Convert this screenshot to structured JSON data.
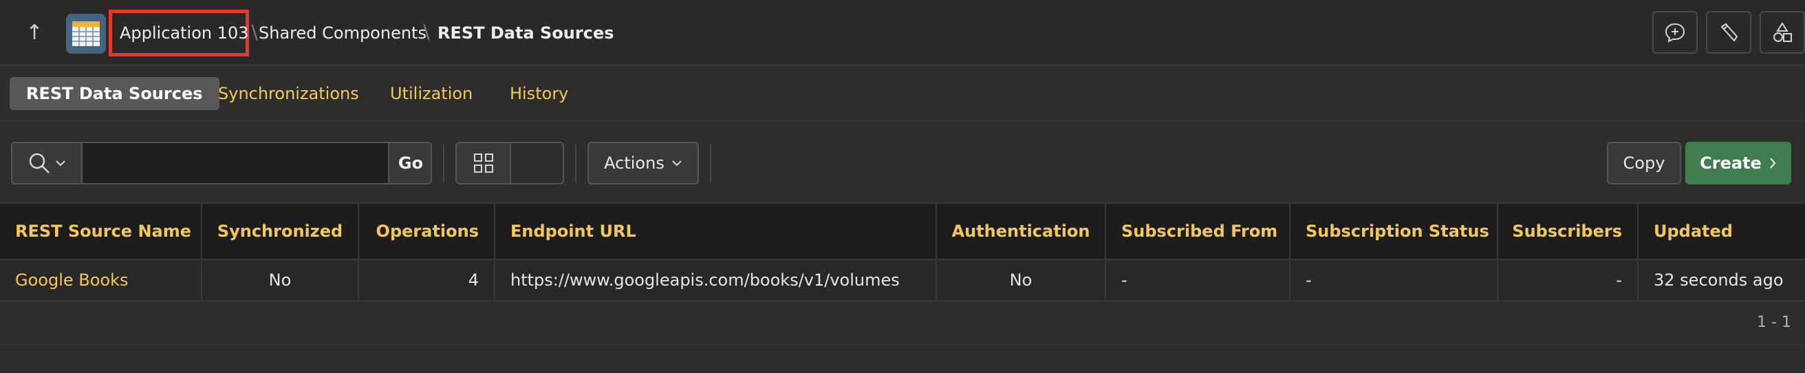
{
  "header": {
    "breadcrumb": [
      "Application 103",
      "Shared Components",
      "REST Data Sources"
    ],
    "icons": [
      "up-arrow-icon",
      "app-grid-icon",
      "feedback-icon",
      "developer-tools-icon",
      "shapes-icon"
    ]
  },
  "tabs": [
    {
      "label": "REST Data Sources",
      "active": true
    },
    {
      "label": "Synchronizations",
      "active": false
    },
    {
      "label": "Utilization",
      "active": false
    },
    {
      "label": "History",
      "active": false
    }
  ],
  "toolbar": {
    "search_value": "",
    "go_label": "Go",
    "actions_label": "Actions",
    "copy_label": "Copy",
    "create_label": "Create"
  },
  "table": {
    "columns": [
      "REST Source Name",
      "Synchronized",
      "Operations",
      "Endpoint URL",
      "Authentication",
      "Subscribed From",
      "Subscription Status",
      "Subscribers",
      "Updated"
    ],
    "rows": [
      [
        "Google Books",
        "No",
        "4",
        "https://www.googleapis.com/books/v1/volumes",
        "No",
        "-",
        "-",
        "-",
        "32 seconds ago"
      ]
    ],
    "pagination": "1 - 1"
  },
  "colors": {
    "accent": "#f2c85a",
    "create": "#3f7d4e",
    "highlight_box": "#e23b2b"
  }
}
